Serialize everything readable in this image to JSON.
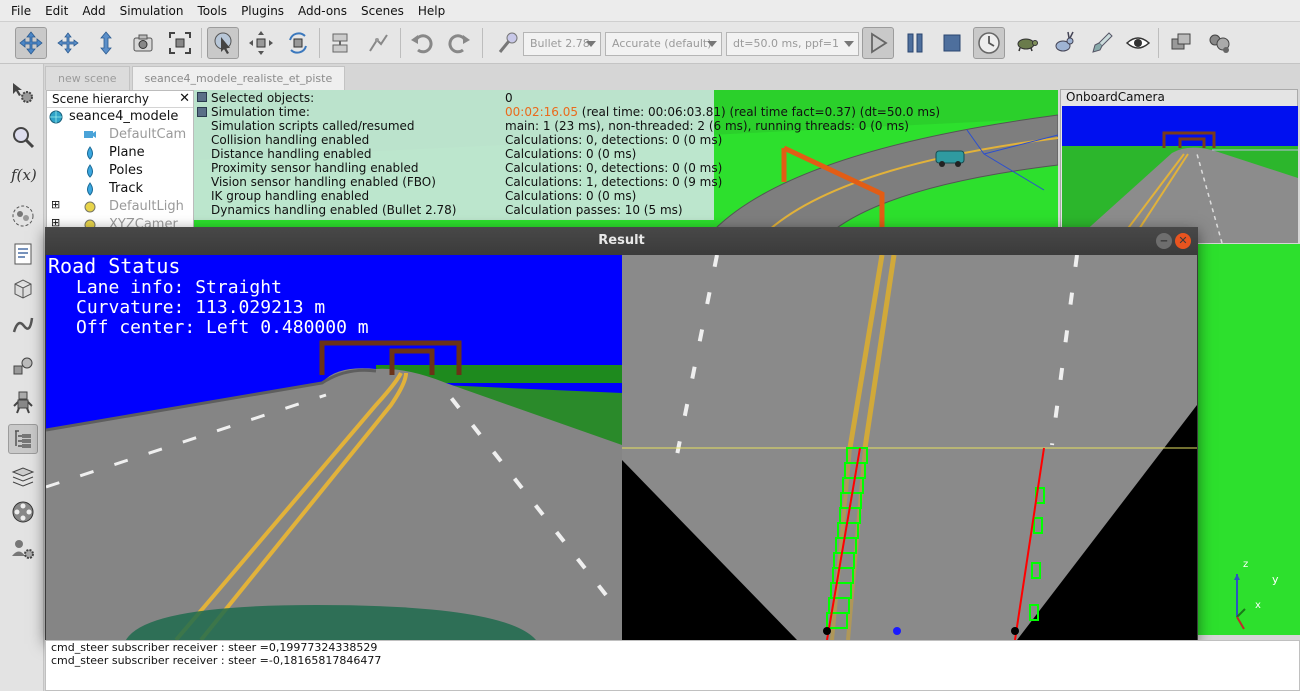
{
  "menu": [
    "File",
    "Edit",
    "Add",
    "Simulation",
    "Tools",
    "Plugins",
    "Add-ons",
    "Scenes",
    "Help"
  ],
  "toolbar": {
    "engine": "Bullet 2.78",
    "accuracy": "Accurate (default)",
    "timestep": "dt=50.0 ms, ppf=1"
  },
  "tabs": [
    "new scene",
    "seance4_modele_realiste_et_piste"
  ],
  "scene_hierarchy": {
    "title": "Scene hierarchy",
    "close": "✕",
    "items": [
      "seance4_modele",
      "DefaultCam",
      "Plane",
      "Poles",
      "Track",
      "DefaultLigh",
      "XYZCamer"
    ]
  },
  "info_panel": {
    "labels": [
      "Selected objects:",
      "Simulation time:",
      "Simulation scripts called/resumed",
      "Collision handling enabled",
      "Distance handling enabled",
      "Proximity sensor handling enabled",
      "Vision sensor handling enabled (FBO)",
      "IK group handling enabled",
      "Dynamics handling enabled (Bullet 2.78)"
    ],
    "sim_time": "00:02:16.05",
    "values": [
      "0",
      " (real time: 00:06:03.81) (real time fact=0.37) (dt=50.0 ms)",
      "main: 1 (23 ms), non-threaded: 2 (6 ms), running threads: 0 (0 ms)",
      "Calculations: 0, detections: 0 (0 ms)",
      "Calculations: 0 (0 ms)",
      "Calculations: 0, detections: 0 (0 ms)",
      "Calculations: 1, detections: 0 (9 ms)",
      "Calculations: 0 (0 ms)",
      "Calculation passes: 10 (5 ms)"
    ]
  },
  "onboard_camera": {
    "title": "OnboardCamera"
  },
  "result_window": {
    "title": "Result",
    "road_status": {
      "heading": "Road Status",
      "lane": "Lane info: Straight",
      "curvature": "Curvature: 113.029213 m",
      "offset": "Off center: Left 0.480000 m"
    }
  },
  "axes": {
    "z": "z",
    "y": "y",
    "x": "x"
  },
  "console": [
    "cmd_steer subscriber receiver : steer =0,19977324338529",
    "cmd_steer subscriber receiver : steer =-0,18165817846477"
  ],
  "colors": {
    "sky": "#0000ff",
    "grass": "#2de02d",
    "road": "#8c8c8c",
    "lane_yellow": "#e3b43a",
    "fit_red": "#ff0000",
    "window_green": "#00ff00"
  }
}
